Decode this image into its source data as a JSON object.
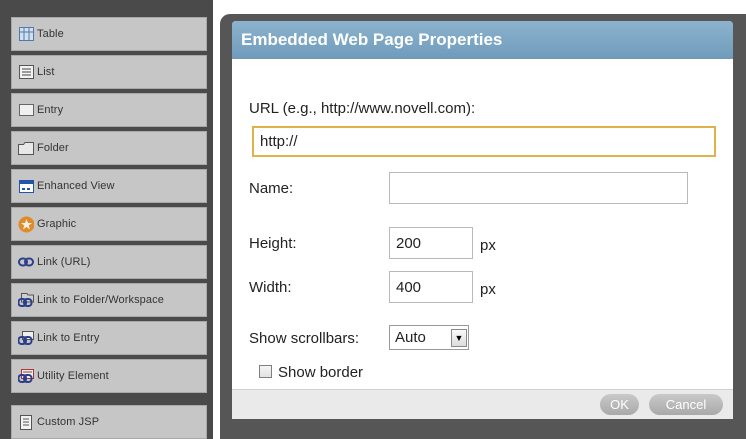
{
  "palette": {
    "items": [
      {
        "label": "Table",
        "icon": "table-icon"
      },
      {
        "label": "List",
        "icon": "list-icon"
      },
      {
        "label": "Entry",
        "icon": "entry-icon"
      },
      {
        "label": "Folder",
        "icon": "folder-icon"
      },
      {
        "label": "Enhanced View",
        "icon": "enhanced-view-icon"
      },
      {
        "label": "Graphic",
        "icon": "graphic-icon"
      },
      {
        "label": "Link (URL)",
        "icon": "link-icon"
      },
      {
        "label": "Link to Folder/Workspace",
        "icon": "link-folder-icon"
      },
      {
        "label": "Link to Entry",
        "icon": "link-entry-icon"
      },
      {
        "label": "Utility Element",
        "icon": "utility-icon"
      },
      {
        "label": "Custom JSP",
        "icon": "jsp-icon"
      }
    ]
  },
  "dialog": {
    "title": "Embedded Web Page Properties",
    "url_label": "URL (e.g., http://www.novell.com):",
    "url_value": "http://",
    "name_label": "Name:",
    "name_value": "",
    "height_label": "Height:",
    "height_value": "200",
    "height_unit": "px",
    "width_label": "Width:",
    "width_value": "400",
    "width_unit": "px",
    "scrollbars_label": "Show scrollbars:",
    "scrollbars_value": "Auto",
    "border_label": "Show border",
    "border_checked": false,
    "ok_label": "OK",
    "cancel_label": "Cancel"
  },
  "colors": {
    "title_bar": "#7ea8c6",
    "frame": "#565656",
    "palette_item": "#c6c6c6",
    "focus_border": "#e0b24a"
  }
}
